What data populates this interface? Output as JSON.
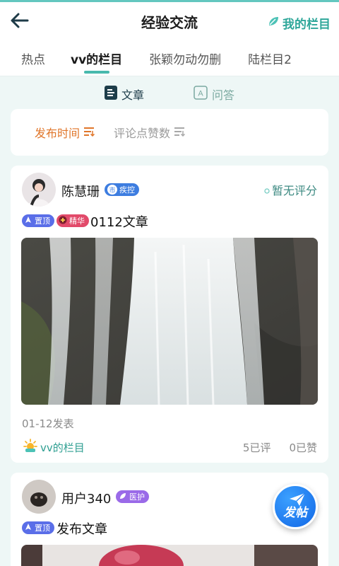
{
  "header": {
    "title": "经验交流",
    "my_columns_label": "我的栏目",
    "back_icon": "arrow-left-icon"
  },
  "tabs": [
    {
      "label": "热点",
      "active": false
    },
    {
      "label": "vv的栏目",
      "active": true
    },
    {
      "label": "张颖勿动勿删",
      "active": false
    },
    {
      "label": "陆栏目2",
      "active": false
    }
  ],
  "content_type": {
    "article": "文章",
    "qa": "问答",
    "active": "article"
  },
  "sort": {
    "by_time": "发布时间",
    "by_comments_likes": "评论点赞数",
    "active": "by_time"
  },
  "posts": [
    {
      "author": "陈慧珊",
      "role_badge": {
        "prefix": "市",
        "label": "疾控"
      },
      "rating": "暂无评分",
      "tags": [
        {
          "label": "置顶"
        },
        {
          "label": "精华"
        }
      ],
      "title": "0112文章",
      "date": "01-12发表",
      "column": "vv的栏目",
      "comments": "5已评",
      "likes": "0已赞"
    },
    {
      "author": "用户340",
      "role_badge": {
        "label": "医护"
      },
      "tags": [
        {
          "label": "置顶"
        }
      ],
      "title": "发布文章"
    }
  ],
  "fab": {
    "label": "发帖"
  },
  "colors": {
    "accent": "#48b9ad",
    "sort_active": "#e0762a",
    "sort_inactive": "#9a9a9a",
    "pin_tag": "#5a6ee8",
    "essence_tag": "#e24a6a",
    "cdc_badge": "#3d7de0",
    "medic_badge": "#9a6ae8",
    "fab": "#1e7cf0"
  }
}
